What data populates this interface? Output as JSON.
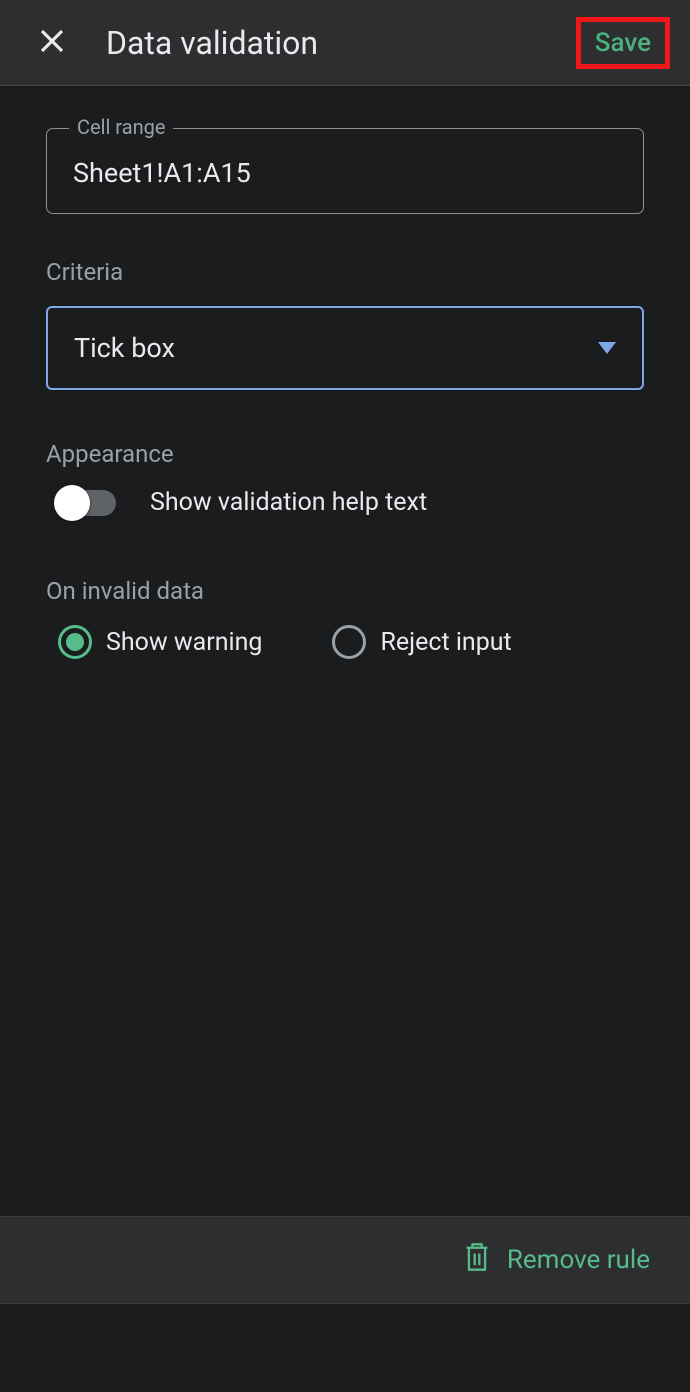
{
  "header": {
    "title": "Data validation",
    "save_label": "Save"
  },
  "cell_range": {
    "label": "Cell range",
    "value": "Sheet1!A1:A15"
  },
  "criteria": {
    "label": "Criteria",
    "selected": "Tick box"
  },
  "appearance": {
    "label": "Appearance",
    "toggle_label": "Show validation help text",
    "toggle_on": false
  },
  "invalid": {
    "label": "On invalid data",
    "options": [
      {
        "label": "Show warning",
        "selected": true
      },
      {
        "label": "Reject input",
        "selected": false
      }
    ]
  },
  "footer": {
    "remove_label": "Remove rule"
  }
}
